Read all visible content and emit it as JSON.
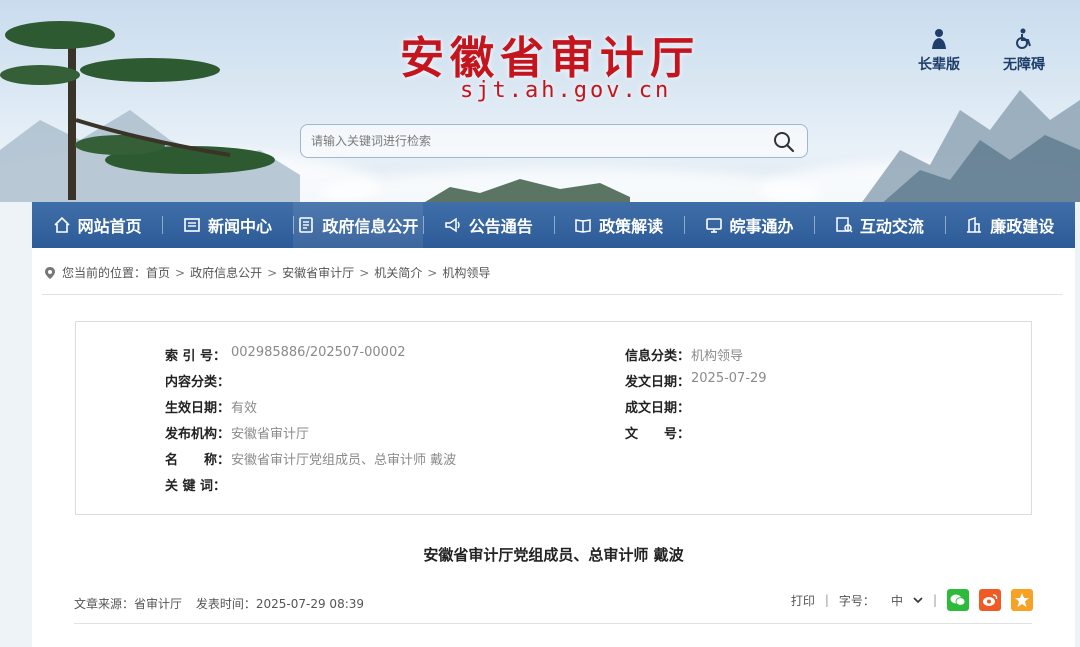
{
  "header": {
    "site_title": "安徽省审计厅",
    "site_domain": "sjt.ah.gov.cn",
    "search_placeholder": "请输入关键词进行检索",
    "tools": [
      {
        "label": "长辈版",
        "icon": "elder-icon"
      },
      {
        "label": "无障碍",
        "icon": "accessibility-icon"
      }
    ]
  },
  "nav": {
    "items": [
      {
        "label": "网站首页",
        "icon": "home-icon"
      },
      {
        "label": "新闻中心",
        "icon": "news-icon"
      },
      {
        "label": "政府信息公开",
        "icon": "document-icon"
      },
      {
        "label": "公告通告",
        "icon": "megaphone-icon"
      },
      {
        "label": "政策解读",
        "icon": "book-icon"
      },
      {
        "label": "皖事通办",
        "icon": "service-icon"
      },
      {
        "label": "互动交流",
        "icon": "chat-icon"
      },
      {
        "label": "廉政建设",
        "icon": "building-icon"
      }
    ],
    "active_index": 2
  },
  "breadcrumb": {
    "prefix": "您当前的位置：",
    "items": [
      "首页",
      "政府信息公开",
      "安徽省审计厅",
      "机关简介",
      "机构领导"
    ],
    "separator": ">"
  },
  "info": {
    "left": [
      {
        "label": "索 引 号：",
        "value": "002985886/202507-00002"
      },
      {
        "label": "内容分类：",
        "value": ""
      },
      {
        "label": "生效日期：",
        "value": "有效"
      },
      {
        "label": "发布机构：",
        "value": "安徽省审计厅"
      },
      {
        "label": "名　　称：",
        "value": "安徽省审计厅党组成员、总审计师 戴波"
      },
      {
        "label": "关 键 词：",
        "value": ""
      }
    ],
    "right": [
      {
        "label": "信息分类：",
        "value": "机构领导"
      },
      {
        "label": "发文日期：",
        "value": "2025-07-29"
      },
      {
        "label": "成文日期：",
        "value": ""
      },
      {
        "label": "文　　号：",
        "value": ""
      }
    ]
  },
  "article": {
    "title": "安徽省审计厅党组成员、总审计师 戴波",
    "source_label": "文章来源：",
    "source": "省审计厅",
    "time_label": "发表时间：",
    "time": "2025-07-29 08:39",
    "print_label": "打印",
    "font_label": "字号：",
    "font_value": "中",
    "share": [
      {
        "name": "wechat",
        "color": "#2dbb3a"
      },
      {
        "name": "weibo",
        "color": "#f15a24"
      },
      {
        "name": "favorite",
        "color": "#f7a125"
      }
    ]
  },
  "colors": {
    "brand_red": "#c4141d",
    "nav_blue": "#2d5b97"
  }
}
